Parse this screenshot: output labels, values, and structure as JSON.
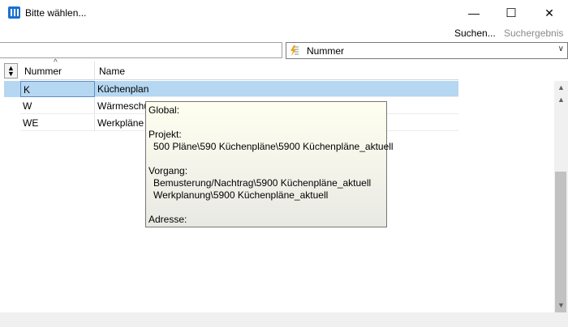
{
  "window": {
    "title": "Bitte wählen...",
    "minimize_glyph": "—",
    "maximize_glyph": "☐",
    "close_glyph": "✕"
  },
  "toolbar": {
    "search_label": "Suchen...",
    "result_label": "Suchergebnis"
  },
  "filter": {
    "search_value": "",
    "field_select_value": "Nummer",
    "field_select_icon": "lightning-list-icon"
  },
  "grid": {
    "columns": [
      "Nummer",
      "Name"
    ],
    "sort_icon": "sort-updown-icon",
    "sort_indicator": "^",
    "rows": [
      {
        "nummer": "K",
        "name": "Küchenplan",
        "selected": true
      },
      {
        "nummer": "W",
        "name": "Wärmeschutz"
      },
      {
        "nummer": "WE",
        "name": "Werkpläne"
      }
    ]
  },
  "tooltip": {
    "global_label": "Global:",
    "projekt_label": "Projekt:",
    "projekt_value": "500 Pläne\\590 Küchenpläne\\5900 Küchenpläne_aktuell",
    "vorgang_label": "Vorgang:",
    "vorgang_line1": "Bemusterung/Nachtrag\\5900 Küchenpläne_aktuell",
    "vorgang_line2": "Werkplanung\\5900 Küchenpläne_aktuell",
    "adresse_label": "Adresse:"
  },
  "colors": {
    "selection": "#b5d7f1",
    "app_icon": "#1a6fd1"
  }
}
